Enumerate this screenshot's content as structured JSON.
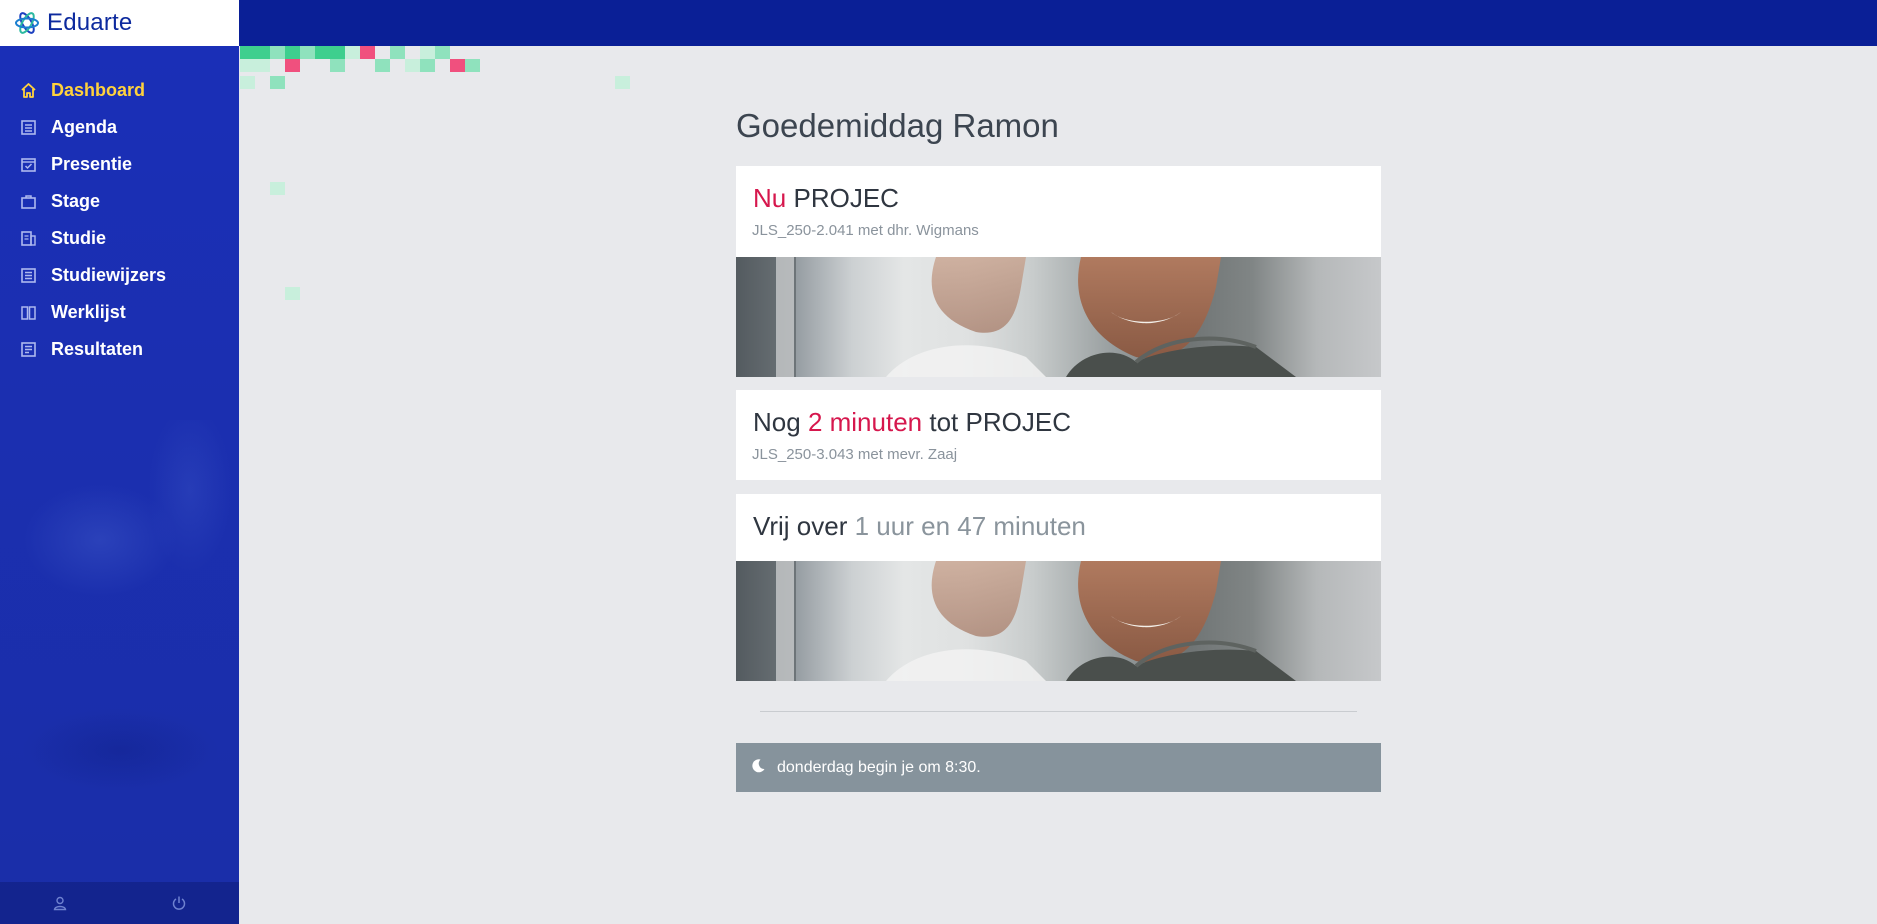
{
  "app": {
    "name": "Eduarte"
  },
  "sidebar": {
    "items": [
      {
        "label": "Dashboard",
        "icon": "home-icon",
        "active": true
      },
      {
        "label": "Agenda",
        "icon": "calendar-icon",
        "active": false
      },
      {
        "label": "Presentie",
        "icon": "check-calendar-icon",
        "active": false
      },
      {
        "label": "Stage",
        "icon": "briefcase-icon",
        "active": false
      },
      {
        "label": "Studie",
        "icon": "study-icon",
        "active": false
      },
      {
        "label": "Studiewijzers",
        "icon": "list-icon",
        "active": false
      },
      {
        "label": "Werklijst",
        "icon": "book-icon",
        "active": false
      },
      {
        "label": "Resultaten",
        "icon": "results-icon",
        "active": false
      }
    ],
    "footer": {
      "profile_icon": "user-icon",
      "logout_icon": "power-icon"
    }
  },
  "main": {
    "greeting": "Goedemiddag Ramon",
    "cards": [
      {
        "prefix": "Nu",
        "title": "PROJEC",
        "subtitle": "JLS_250-2.041 met dhr. Wigmans"
      },
      {
        "lead": "Nog",
        "highlight": "2 minuten",
        "middle": "tot",
        "title": "PROJEC",
        "subtitle": "JLS_250-3.043 met mevr. Zaaj"
      },
      {
        "lead": "Vrij over",
        "duration": "1 uur en 47 minuten"
      }
    ],
    "notice": {
      "icon": "moon-icon",
      "text": "donderdag begin je om 8:30."
    }
  },
  "colors": {
    "topbar": "#0a1f96",
    "sidebar": "#1a2fb8",
    "active_nav": "#ffd23c",
    "accent_red": "#d6174d",
    "notice_bg": "#86939c",
    "page_bg": "#e8e9ec"
  }
}
